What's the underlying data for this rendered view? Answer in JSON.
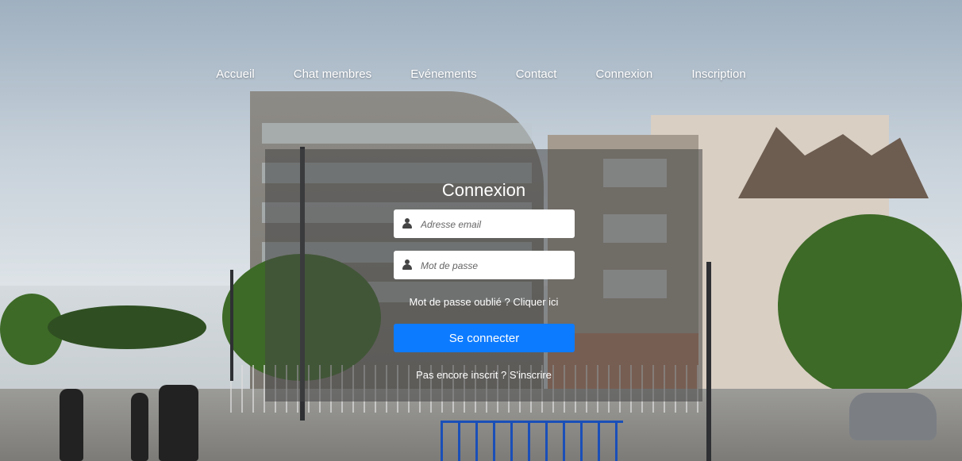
{
  "nav": {
    "items": [
      "Accueil",
      "Chat membres",
      "Evénements",
      "Contact",
      "Connexion",
      "Inscription"
    ]
  },
  "login": {
    "title": "Connexion",
    "email_placeholder": "Adresse email",
    "password_placeholder": "Mot de passe",
    "forgot_text": "Mot de passe oublié ? Cliquer ici",
    "submit_label": "Se connecter",
    "signup_text": "Pas encore inscrit ? S'inscrire"
  },
  "colors": {
    "button": "#0d7bff",
    "panel_overlay": "rgba(70,70,70,0.55)"
  },
  "icons": {
    "email_field": "user-icon",
    "password_field": "user-icon"
  }
}
